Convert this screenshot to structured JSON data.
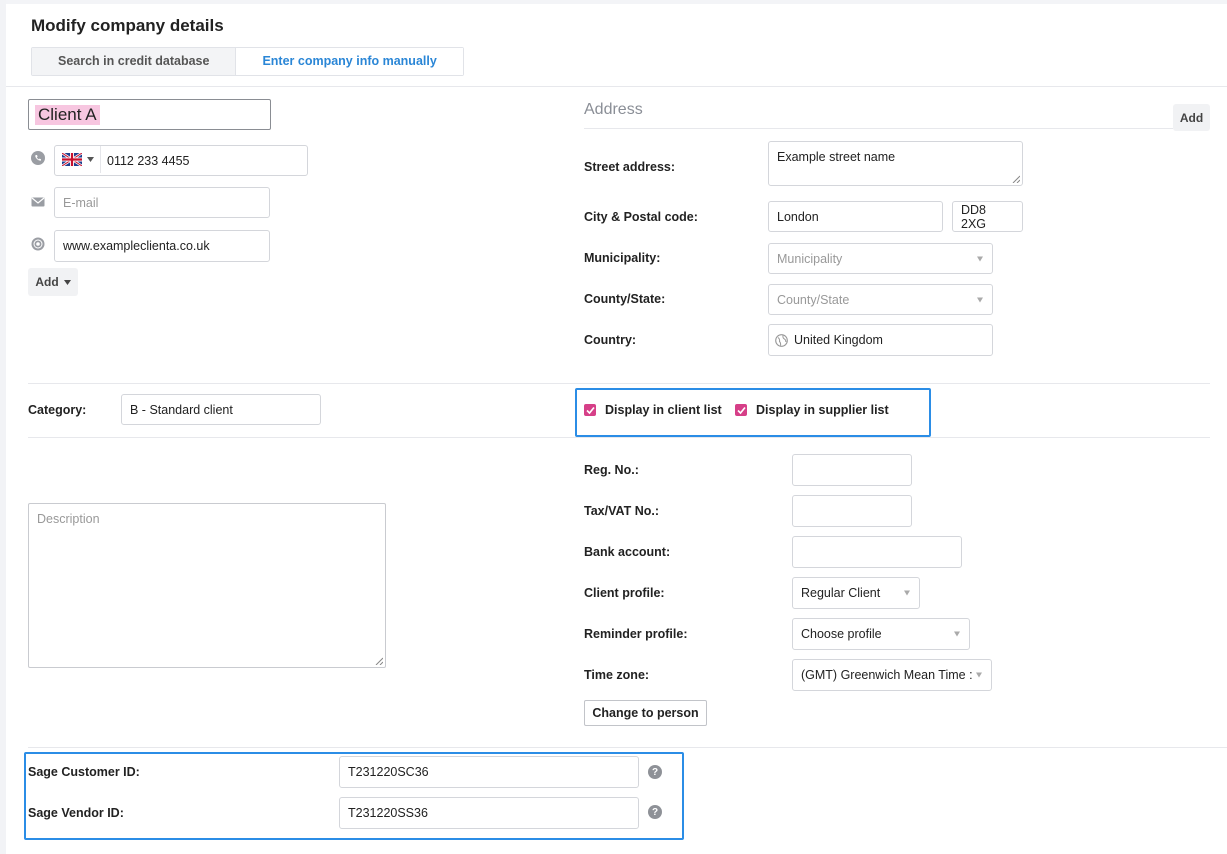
{
  "page": {
    "title": "Modify company details"
  },
  "tabs": [
    {
      "label": "Search in credit database",
      "active": false
    },
    {
      "label": "Enter company info manually",
      "active": true
    }
  ],
  "contact": {
    "company_name": "Client A",
    "phone_value": "0112 233 4455",
    "email_placeholder": "E-mail",
    "website_value": "www.exampleclienta.co.uk",
    "add_label": "Add"
  },
  "address": {
    "heading": "Address",
    "add_label": "Add",
    "street_label": "Street address:",
    "street_value": "Example street name",
    "city_postal_label": "City & Postal code:",
    "city_value": "London",
    "postal_value": "DD8 2XG",
    "municipality_label": "Municipality:",
    "municipality_placeholder": "Municipality",
    "county_label": "County/State:",
    "county_placeholder": "County/State",
    "country_label": "Country:",
    "country_value": "United Kingdom"
  },
  "category": {
    "label": "Category:",
    "value": "B - Standard client"
  },
  "display": {
    "client_list_label": "Display in client list",
    "client_list_checked": true,
    "supplier_list_label": "Display in supplier list",
    "supplier_list_checked": true
  },
  "description": {
    "placeholder": "Description"
  },
  "details": {
    "reg_label": "Reg. No.:",
    "tax_label": "Tax/VAT No.:",
    "bank_label": "Bank account:",
    "client_profile_label": "Client profile:",
    "client_profile_value": "Regular Client",
    "reminder_label": "Reminder profile:",
    "reminder_value": "Choose profile",
    "timezone_label": "Time zone:",
    "timezone_value": "(GMT) Greenwich Mean Time :",
    "change_button": "Change to person"
  },
  "sage": {
    "customer_label": "Sage Customer ID:",
    "customer_value": "T231220SC36",
    "vendor_label": "Sage Vendor ID:",
    "vendor_value": "T231220SS36",
    "help_glyph": "?"
  },
  "colors": {
    "accent": "#2b8de6",
    "checkbox": "#d63f88",
    "highlight": "#f7c6e0",
    "tab_active": "#2a86d6"
  }
}
